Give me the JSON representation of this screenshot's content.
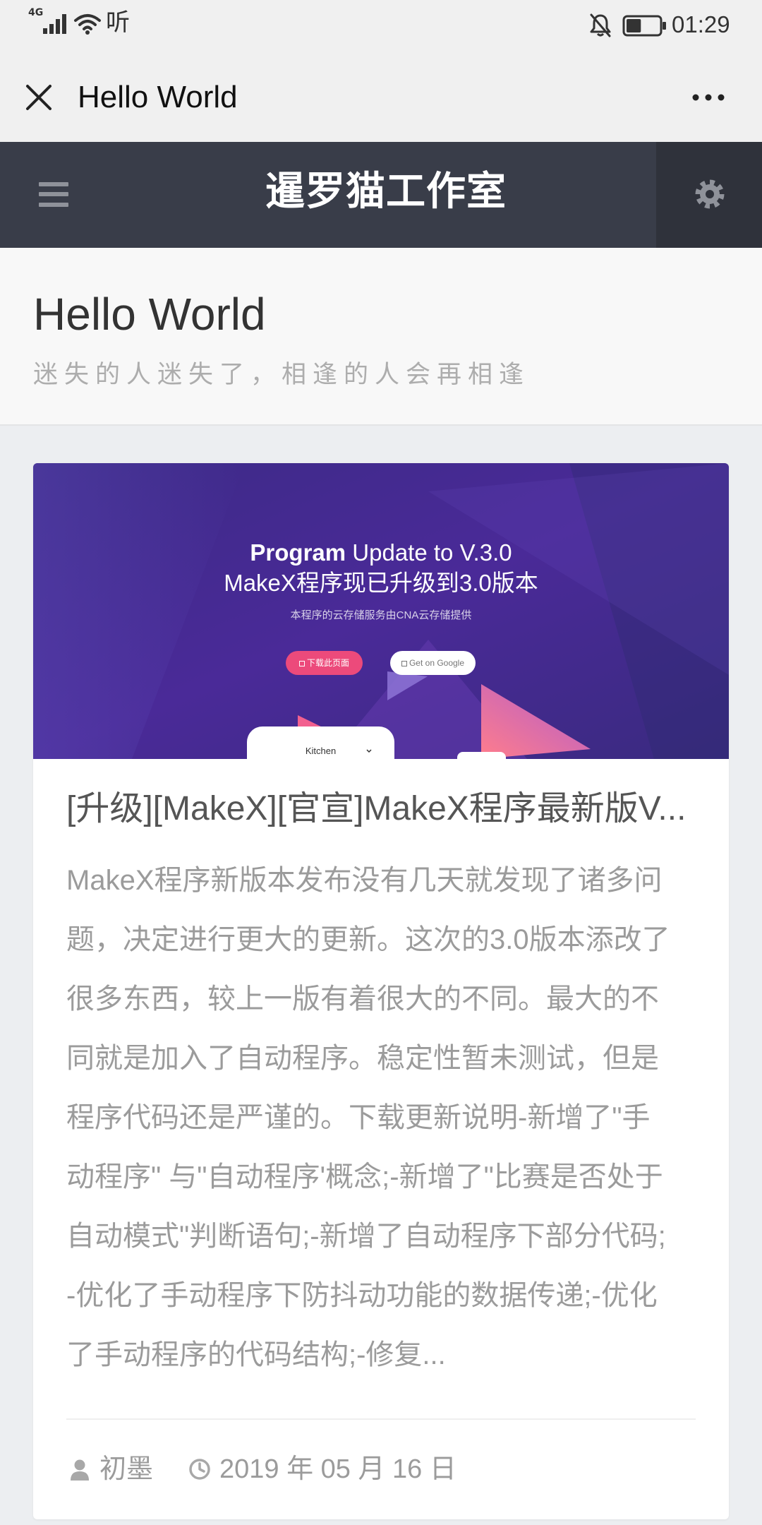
{
  "status_bar": {
    "network": "4G",
    "extra_glyph": "听",
    "time": "01:29",
    "battery_level": 45
  },
  "titlebar": {
    "title": "Hello World"
  },
  "site_header": {
    "title": "暹罗猫工作室"
  },
  "page_header": {
    "title": "Hello World",
    "subtitle": "迷失的人迷失了，相逢的人会再相逢"
  },
  "post": {
    "banner": {
      "heading_bold": "Program",
      "heading_rest": " Update to V.3.0",
      "heading_cn": "MakeX程序现已升级到3.0版本",
      "note": "本程序的云存储服务由CNA云存储提供",
      "primary_button": "下载此页面",
      "secondary_button": "Get on Google",
      "mockup_label": "Kitchen"
    },
    "title": "[升级][MakeX][官宣]MakeX程序最新版V...",
    "excerpt_lines": [
      "MakeX程序新版本发布没有几天就发现了诸多问",
      "题，决定进行更大的更新。这次的3.0版本添改了",
      "很多东西，较上一版有着很大的不同。最大的不",
      "同就是加入了自动程序。稳定性暂未测试，但是",
      "程序代码还是严谨的。下载更新说明-新增了\"手",
      "动程序\" 与\"自动程序'概念;-新增了\"比赛是否处于",
      "自动模式\"判断语句;-新增了自动程序下部分代码;",
      "-优化了手动程序下防抖动功能的数据传递;-优化",
      "了手动程序的代码结构;-修复..."
    ],
    "author": "初墨",
    "date": "2019 年 05 月 16 日"
  },
  "icons": {
    "close": "close-icon",
    "more": "more-dots-icon",
    "menu": "hamburger-menu-icon",
    "settings": "gear-icon",
    "author": "user-icon",
    "date": "clock-icon"
  },
  "colors": {
    "site_header_bg": "#393d49",
    "site_header_right_bg": "#2f323b",
    "banner_primary_button": "#ec4a7b"
  }
}
